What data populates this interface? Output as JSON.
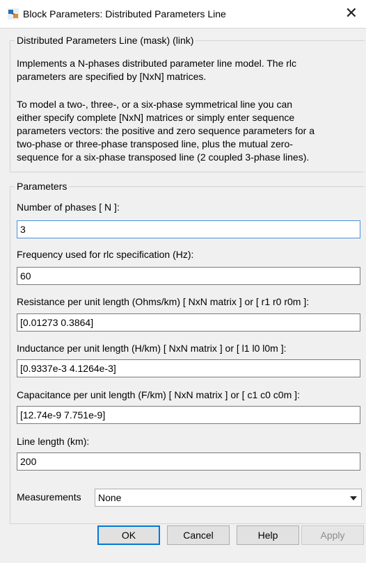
{
  "window": {
    "title": "Block Parameters: Distributed Parameters Line",
    "close_glyph": "✕",
    "icon": "simulink-block-icon"
  },
  "mask": {
    "legend": "Distributed Parameters Line (mask) (link)",
    "description_lines_1": [
      "Implements a N-phases distributed parameter line model. The rlc",
      "parameters are specified by [NxN] matrices."
    ],
    "description_lines_2": [
      "To model a two-, three-, or a six-phase symmetrical line you can",
      "either specify complete [NxN] matrices or simply enter sequence",
      "parameters vectors: the  positive and zero sequence parameters for a",
      "two-phase or  three-phase transposed  line, plus the mutual zero-",
      "sequence for a  six-phase transposed  line  (2 coupled 3-phase lines)."
    ]
  },
  "parameters": {
    "legend": "Parameters",
    "fields": [
      {
        "label": "Number of phases [ N ]:",
        "value": "3"
      },
      {
        "label": "Frequency used for rlc specification (Hz):",
        "value": "60"
      },
      {
        "label": "Resistance per unit length (Ohms/km) [ NxN matrix ] or [ r1 r0 r0m ]:",
        "value": "[0.01273 0.3864]"
      },
      {
        "label": "Inductance per unit length (H/km) [ NxN matrix ] or [ l1 l0 l0m ]:",
        "value": "[0.9337e-3  4.1264e-3]"
      },
      {
        "label": "Capacitance per unit length (F/km) [ NxN matrix ] or [ c1 c0 c0m ]:",
        "value": "[12.74e-9 7.751e-9]"
      },
      {
        "label": "Line length (km):",
        "value": "200"
      }
    ],
    "measurements_label": "Measurements",
    "measurements_value": "None"
  },
  "buttons": {
    "ok": "OK",
    "cancel": "Cancel",
    "help": "Help",
    "apply": "Apply"
  }
}
